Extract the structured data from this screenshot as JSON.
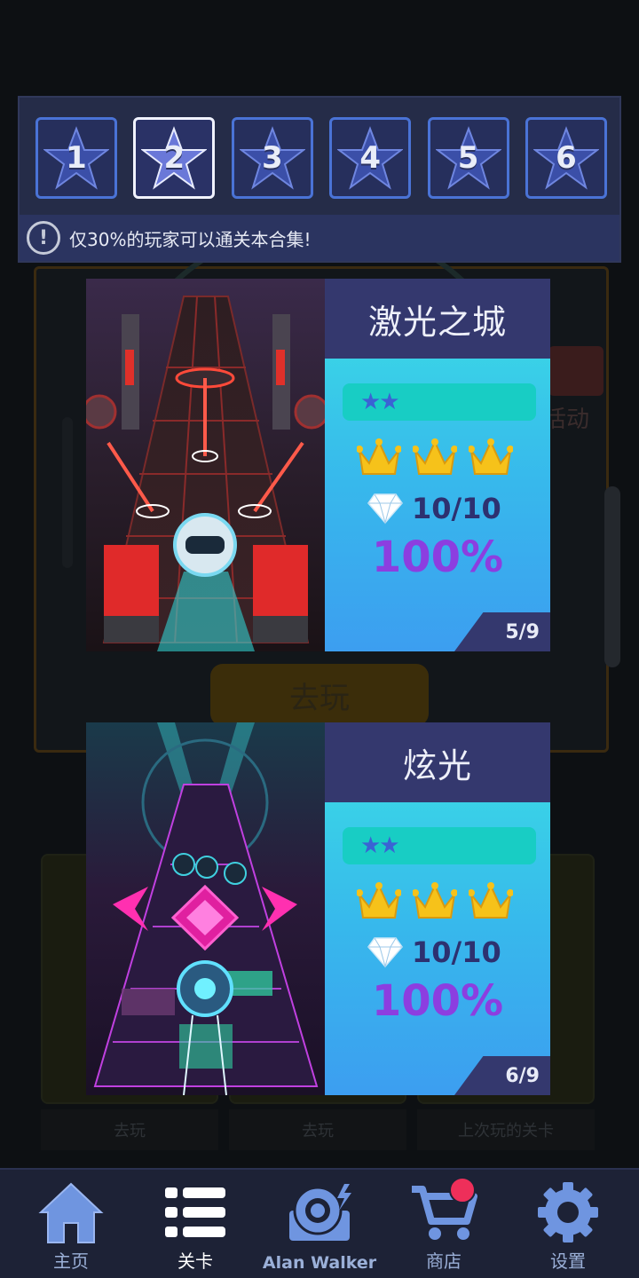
{
  "collection": {
    "tabs": [
      {
        "number": "1",
        "selected": false
      },
      {
        "number": "2",
        "selected": true
      },
      {
        "number": "3",
        "selected": false
      },
      {
        "number": "4",
        "selected": false
      },
      {
        "number": "5",
        "selected": false
      },
      {
        "number": "6",
        "selected": false
      }
    ],
    "notice": "仅30%的玩家可以通关本合集!"
  },
  "levels": [
    {
      "title": "激光之城",
      "difficulty_stars": 2,
      "crowns": 3,
      "gems": "10/10",
      "progress": "100%",
      "index": "5/9"
    },
    {
      "title": "炫光",
      "difficulty_stars": 2,
      "crowns": 3,
      "gems": "10/10",
      "progress": "100%",
      "index": "6/9"
    }
  ],
  "background": {
    "play_label": "去玩",
    "event_label": "活动",
    "card_labels": [
      "去玩",
      "去玩",
      "上次玩的关卡"
    ]
  },
  "nav": {
    "home": "主页",
    "levels": "关卡",
    "alan_walker": "Alan Walker",
    "shop": "商店",
    "settings": "设置"
  },
  "colors": {
    "panel": "#252c48",
    "tab_border": "#4a73d6",
    "info_gradient_top": "#3be0e4",
    "info_gradient_bottom": "#3c9ef0",
    "percent": "#8c3ee0",
    "badge": "#ee2f5a"
  }
}
